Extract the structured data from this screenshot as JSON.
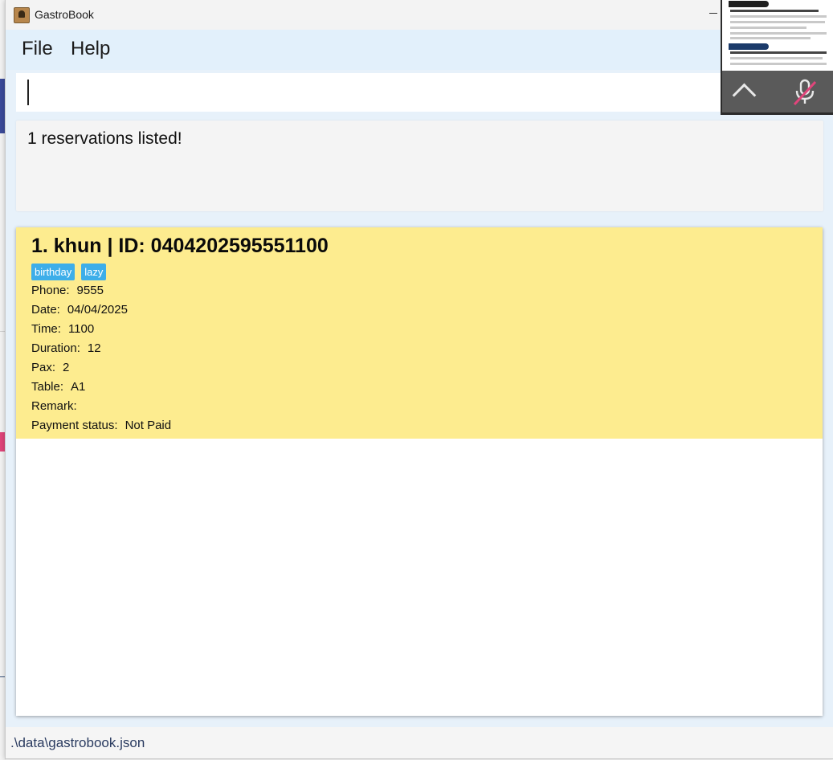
{
  "window": {
    "title": "GastroBook"
  },
  "menu": {
    "file": "File",
    "help": "Help"
  },
  "command_box": {
    "value": ""
  },
  "result": {
    "message": "1 reservations listed!"
  },
  "reservations": [
    {
      "title": "1. khun | ID: 0404202595551100",
      "tags": [
        "birthday",
        "lazy"
      ],
      "fields": [
        {
          "label": "Phone:",
          "value": "9555"
        },
        {
          "label": "Date:",
          "value": "04/04/2025"
        },
        {
          "label": "Time:",
          "value": "1100"
        },
        {
          "label": "Duration:",
          "value": "12"
        },
        {
          "label": "Pax:",
          "value": "2"
        },
        {
          "label": "Table:",
          "value": "A1"
        },
        {
          "label": "Remark:",
          "value": ""
        },
        {
          "label": "Payment status:",
          "value": "Not Paid"
        }
      ]
    }
  ],
  "status_bar": {
    "path": ".\\data\\gastrobook.json"
  },
  "colors": {
    "card": "#fdec8f",
    "tag": "#3daee9",
    "menubar": "#e2f0fb"
  },
  "icons": [
    "app-icon",
    "chevron-up-icon",
    "mic-muted-icon"
  ]
}
